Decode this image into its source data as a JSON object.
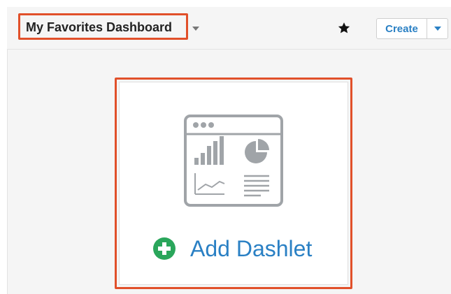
{
  "top_strip": {
    "partial_text": ""
  },
  "header": {
    "dashboard_title": "My Favorites Dashboard",
    "favorite_icon": "star-icon",
    "create_label": "Create",
    "create_menu_icon": "caret-down-icon"
  },
  "dashlet": {
    "illustration_icon": "dashboard-chart-icon",
    "add_icon": "plus-circle-icon",
    "add_label": "Add Dashlet"
  },
  "colors": {
    "highlight": "#e1502a",
    "link_blue": "#2a80c4",
    "add_green": "#2aa65b",
    "illustration_gray": "#a0a4a8",
    "background": "#f5f5f5"
  }
}
